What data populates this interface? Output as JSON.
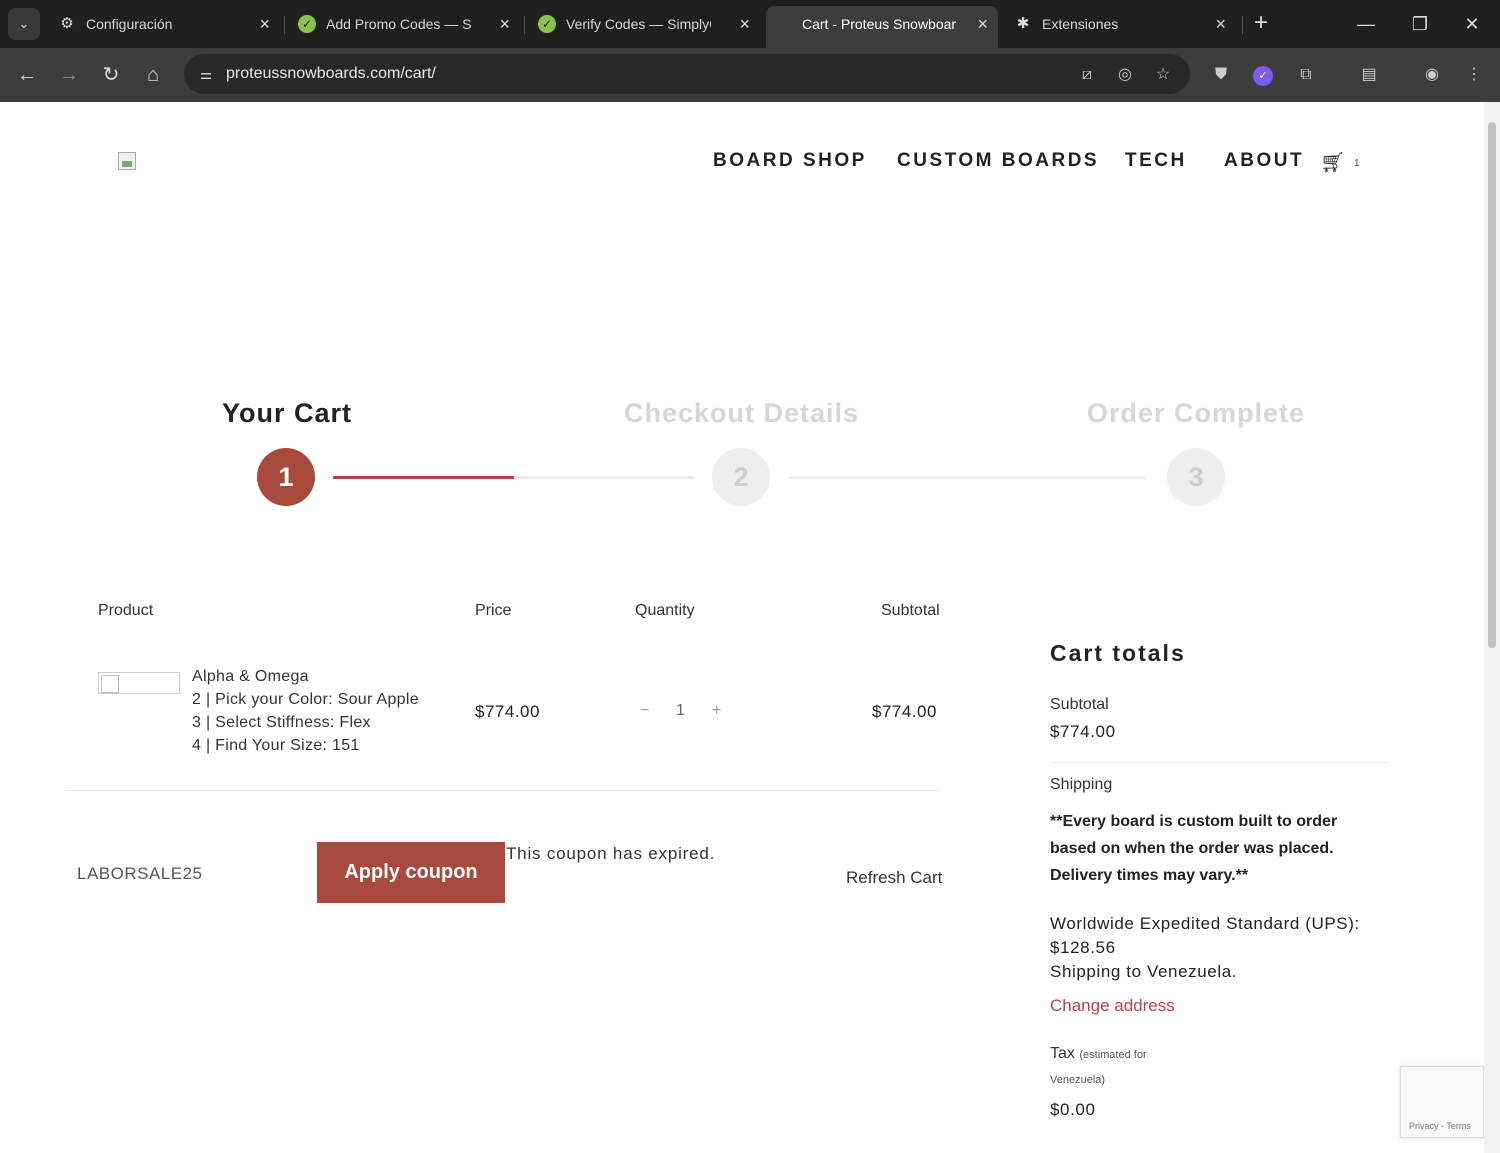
{
  "browser": {
    "tabs": [
      {
        "title": "Configuración",
        "icon": "gear-icon"
      },
      {
        "title": "Add Promo Codes — Sim",
        "icon": "simplycodes-icon"
      },
      {
        "title": "Verify Codes — SimplyC",
        "icon": "simplycodes-icon"
      },
      {
        "title": "Cart - Proteus Snowboar",
        "icon": "page-icon"
      },
      {
        "title": "Extensiones",
        "icon": "puzzle-icon"
      }
    ],
    "url": "proteussnowboards.com/cart/"
  },
  "site": {
    "nav": [
      "BOARD SHOP",
      "CUSTOM BOARDS",
      "TECH",
      "ABOUT"
    ],
    "cart_count": "1"
  },
  "steps": [
    {
      "title": "Your Cart",
      "number": "1"
    },
    {
      "title": "Checkout Details",
      "number": "2"
    },
    {
      "title": "Order Complete",
      "number": "3"
    }
  ],
  "cart": {
    "headers": {
      "product": "Product",
      "price": "Price",
      "quantity": "Quantity",
      "subtotal": "Subtotal"
    },
    "item": {
      "name": "Alpha & Omega",
      "options": [
        "2 | Pick your Color: Sour Apple",
        "3 | Select Stiffness: Flex",
        "4 | Find Your Size: 151"
      ],
      "price": "$774.00",
      "quantity": "1",
      "minus": "−",
      "plus": "+",
      "subtotal": "$774.00"
    },
    "coupon": {
      "value": "LABORSALE25",
      "apply_label": "Apply coupon",
      "message": "This coupon has expired."
    },
    "refresh_label": "Refresh Cart"
  },
  "totals": {
    "title": "Cart totals",
    "subtotal_label": "Subtotal",
    "subtotal_value": "$774.00",
    "shipping_label": "Shipping",
    "shipping_note": "**Every board is custom built to order based on when the order was placed. Delivery times may vary.**",
    "shipping_method": "Worldwide Expedited Standard (UPS):",
    "shipping_cost": "$128.56",
    "shipping_to": "Shipping to Venezuela.",
    "change_address": "Change address",
    "tax_label": "Tax",
    "tax_est_a": "(estimated for",
    "tax_est_b": "Venezuela)",
    "tax_value": "$0.00"
  },
  "recaptcha": {
    "text": "Privacy - Terms"
  },
  "colors": {
    "accent": "#a84a3b",
    "progress": "#b93f4a",
    "link": "#b93f4a"
  }
}
